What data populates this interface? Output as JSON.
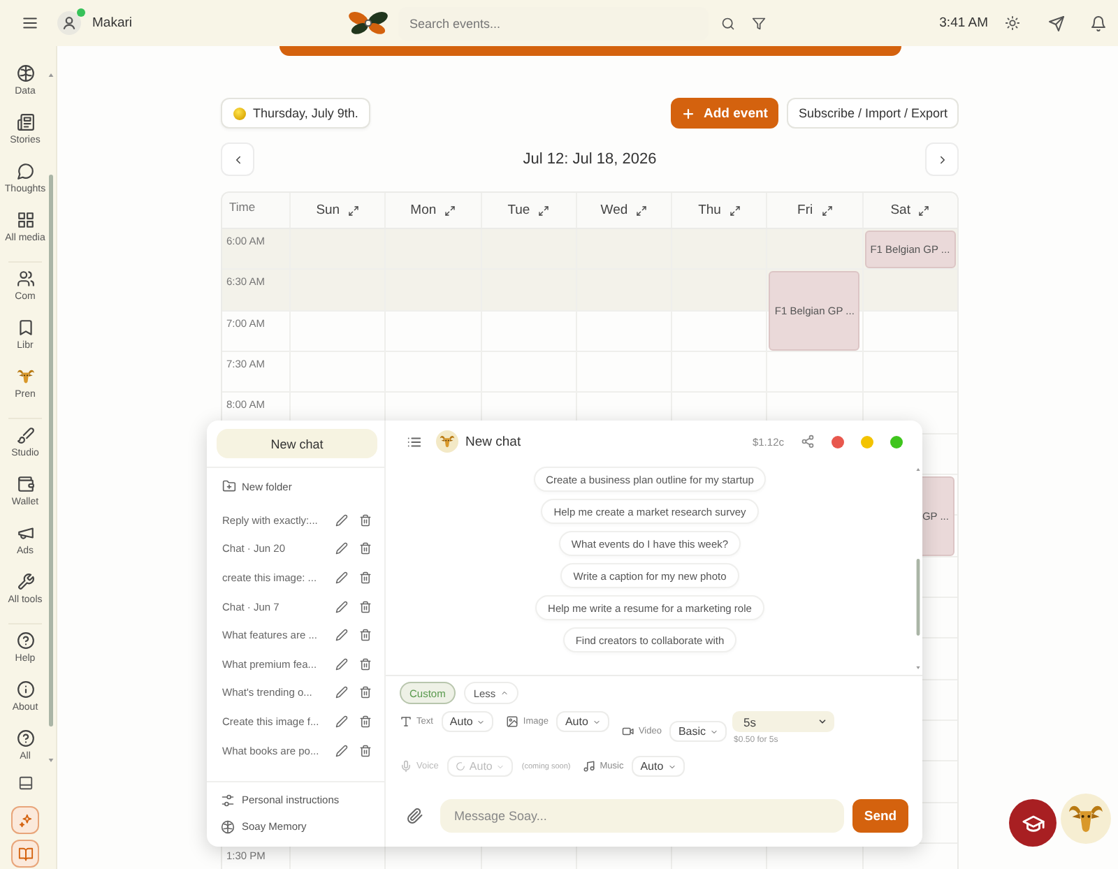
{
  "top_bar": {
    "user": {
      "name": "Makari",
      "online": true
    },
    "search": {
      "placeholder": "Search events..."
    },
    "time": "3:41 AM"
  },
  "sidebar": {
    "groups": [
      {
        "items": [
          {
            "label": "Data",
            "selected": false
          },
          {
            "label": "Stories",
            "selected": false
          },
          {
            "label": "Thoughts",
            "selected": false
          },
          {
            "label": "All media",
            "selected": false
          }
        ]
      },
      {
        "items": [
          {
            "label": "Com",
            "selected": false
          },
          {
            "label": "Libr",
            "selected": false
          },
          {
            "label": "Pren",
            "selected": false
          }
        ]
      },
      {
        "items": [
          {
            "label": "Studio",
            "selected": false
          },
          {
            "label": "Wallet",
            "selected": false
          },
          {
            "label": "Ads",
            "selected": false
          },
          {
            "label": "All tools",
            "selected": false
          }
        ]
      },
      {
        "items": [
          {
            "label": "Help",
            "selected": false
          },
          {
            "label": "About",
            "selected": false
          },
          {
            "label": "All",
            "selected": false
          }
        ]
      }
    ]
  },
  "calendar": {
    "today_button": "Thursday, July 9th.",
    "add_event_button": "Add event",
    "subscribe_button": "Subscribe / Import / Export",
    "range": "Jul 12: Jul 18, 2026",
    "time_header": "Time",
    "days": [
      {
        "label": "Sun"
      },
      {
        "label": "Mon"
      },
      {
        "label": "Tue"
      },
      {
        "label": "Wed"
      },
      {
        "label": "Thu"
      },
      {
        "label": "Fri",
        "schedule": [
          {
            "kind": "free-slot"
          },
          {
            "kind": "long-event",
            "title": "F1 Belgian GP ..."
          }
        ]
      },
      {
        "label": "Sat",
        "schedule": [
          {
            "kind": "short-event",
            "title": "F1 Belgian GP ..."
          },
          {
            "kind": "free-slot"
          },
          {
            "kind": "free-slot"
          },
          {
            "kind": "free-slot"
          },
          {
            "kind": "free-slot"
          },
          {
            "kind": "free-slot"
          },
          {
            "kind": "long-event",
            "title": "GP ..."
          }
        ]
      }
    ],
    "time_rows": [
      {
        "label": "6:00 AM",
        "highlighted": true
      },
      {
        "label": "6:30 AM",
        "highlighted": true
      },
      {
        "label": "7:00 AM",
        "highlighted": false
      },
      {
        "label": "7:30 AM",
        "highlighted": false
      },
      {
        "label": "8:00 AM",
        "highlighted": false
      },
      {
        "highlighted": false
      },
      {
        "highlighted": false
      },
      {
        "highlighted": false
      },
      {
        "highlighted": false
      },
      {
        "highlighted": false
      },
      {
        "highlighted": false
      },
      {
        "highlighted": false
      },
      {
        "highlighted": false
      },
      {
        "highlighted": false
      },
      {
        "highlighted": false
      },
      {
        "label": "1:30 PM",
        "highlighted": false
      }
    ]
  },
  "chat": {
    "new_chat_button": "New chat",
    "new_folder": "New folder",
    "history": [
      {
        "title": "Reply with exactly:...",
        "selected": false
      },
      {
        "title": "Chat · Jun 20",
        "selected": false
      },
      {
        "title": "create this image: ...",
        "selected": false
      },
      {
        "title": "Chat · Jun 7",
        "selected": false
      },
      {
        "title": "What features are ...",
        "selected": false
      },
      {
        "title": "What premium fea...",
        "selected": false
      },
      {
        "title": "What's trending o...",
        "selected": false
      },
      {
        "title": "Create this image f...",
        "selected": false
      },
      {
        "title": "What books are po...",
        "selected": false
      }
    ],
    "personal_instructions": "Personal instructions",
    "memory": "Soay Memory",
    "title": "New chat",
    "cost": "$1.12c",
    "suggestions": [
      "Create a business plan outline for my startup",
      "Help me create a market research survey",
      "What events do I have this week?",
      "Write a caption for my new photo",
      "Help me write a resume for a marketing role",
      "Find creators to collaborate with"
    ],
    "custom_chip": {
      "label": "Custom",
      "selected": true
    },
    "less_toggle": {
      "label": "Less",
      "expanded": true
    },
    "options": [
      {
        "items": [
          {
            "label": "Text",
            "value": "Auto",
            "disabled": false
          },
          {
            "label": "Image",
            "value": "Auto",
            "disabled": false
          },
          {
            "label": "Video",
            "value": "Basic",
            "disabled": false,
            "duration": {
              "value": "5s",
              "price": "$0.50 for 5s"
            }
          }
        ]
      },
      {
        "items": [
          {
            "label": "Voice",
            "value": "Auto",
            "disabled": true,
            "note": "(coming soon)"
          },
          {
            "label": "Music",
            "value": "Auto",
            "disabled": false
          }
        ]
      }
    ],
    "message": {
      "placeholder": "Message Soay..."
    },
    "send_button": "Send"
  }
}
